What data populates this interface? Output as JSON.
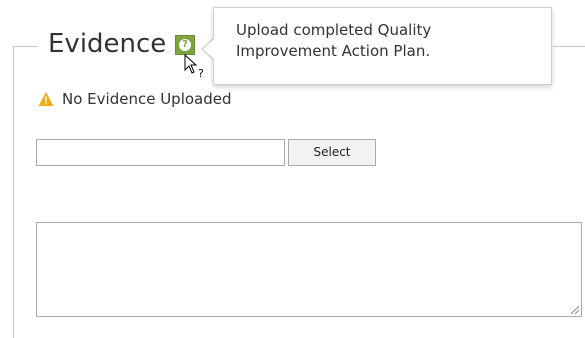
{
  "section": {
    "legend": "Evidence",
    "help_icon_glyph": "?",
    "status_text": "No Evidence Uploaded",
    "status_icon": "warning-icon"
  },
  "tooltip": {
    "text": "Upload completed Quality Improvement Action Plan."
  },
  "file_upload": {
    "value": "",
    "button_label": "Select"
  },
  "comment": {
    "value": ""
  },
  "colors": {
    "help_icon": "#7fa33f",
    "warning": "#f0ad1a",
    "border": "#a9a9a9",
    "fieldset_border": "#c8c8c8"
  }
}
